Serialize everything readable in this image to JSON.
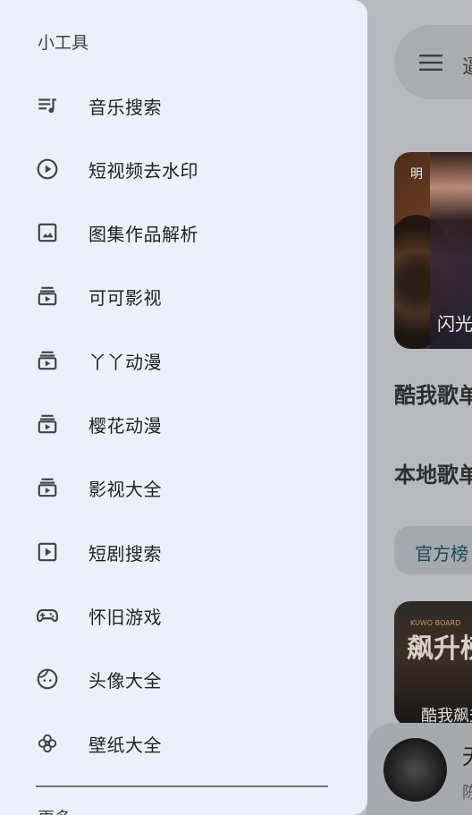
{
  "background": {
    "search_text": "逼",
    "card_label": "明",
    "card_caption": "闪光",
    "section_1": "酷我歌单",
    "section_2": "本地歌单",
    "chip": "官方榜",
    "chart_board": "KUWO BOARD",
    "chart_title": "飙升榜",
    "chart_caption": "酷我飙升",
    "player_title": "无",
    "player_subtitle": "陈"
  },
  "drawer": {
    "title": "小工具",
    "items": [
      {
        "label": "音乐搜索",
        "icon": "music-queue-icon"
      },
      {
        "label": "短视频去水印",
        "icon": "play-circle-icon"
      },
      {
        "label": "图集作品解析",
        "icon": "image-icon"
      },
      {
        "label": "可可影视",
        "icon": "video-library-icon"
      },
      {
        "label": "丫丫动漫",
        "icon": "video-library-icon"
      },
      {
        "label": "樱花动漫",
        "icon": "video-library-icon"
      },
      {
        "label": "影视大全",
        "icon": "video-library-icon"
      },
      {
        "label": "短剧搜索",
        "icon": "play-square-icon"
      },
      {
        "label": "怀旧游戏",
        "icon": "gamepad-icon"
      },
      {
        "label": "头像大全",
        "icon": "face-icon"
      },
      {
        "label": "壁纸大全",
        "icon": "flower-icon"
      }
    ],
    "more_label": "更多"
  },
  "colors": {
    "drawer_bg": "#ebf1f8",
    "scrim_bg": "#b6b9bd",
    "text_primary": "#202326",
    "icon": "#3f4348"
  }
}
